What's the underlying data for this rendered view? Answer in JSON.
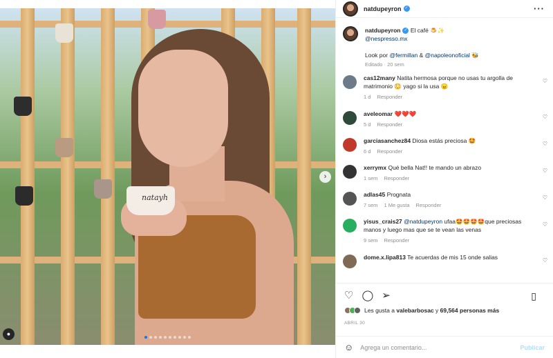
{
  "header": {
    "username": "natdupeyron",
    "more_icon": "more-horizontal-icon"
  },
  "photo": {
    "cup_text": "natayh",
    "slide_count": 10,
    "active_slide": 1
  },
  "caption": {
    "username": "natdupeyron",
    "line1": "El café 🍮✨",
    "line2": "@nespresso.mx",
    "line3_prefix": "Look por ",
    "mention1": "@fermillan",
    "and": " & ",
    "mention2": "@napoleonoficial",
    "line3_suffix": " 🐝",
    "meta": "Editado · 20 sem"
  },
  "comments": [
    {
      "user": "cas12many",
      "text": "Natita hermosa porque no usas tu argolla de matrimonio 😳 yago si la usa 😠",
      "time": "1 d",
      "reply": "Responder",
      "likes": "",
      "color": "#6c7a89"
    },
    {
      "user": "aveleomar",
      "text": "❤️❤️❤️",
      "time": "5 d",
      "reply": "Responder",
      "likes": "",
      "color": "#2e4a3a"
    },
    {
      "user": "garciasanchez84",
      "text": "Diosa estás preciosa 🤩",
      "time": "6 d",
      "reply": "Responder",
      "likes": "",
      "color": "#c0392b"
    },
    {
      "user": "xerrymx",
      "text": "Qué bella Nat!! te mando un abrazo",
      "time": "1 sem",
      "reply": "Responder",
      "likes": "",
      "color": "#333333"
    },
    {
      "user": "adlas45",
      "text": "Prognata",
      "time": "7 sem",
      "reply": "Responder",
      "likes": "1 Me gusta",
      "color": "#555555"
    },
    {
      "user": "yisus_crais27",
      "mention": "@natdupeyron",
      "text": "ufaa🤩🤩🤩🤩que preciosas manos y luego mas que se te vean las venas",
      "time": "9 sem",
      "reply": "Responder",
      "likes": "",
      "color": "#27ae60"
    },
    {
      "user": "dome.x.lipa813",
      "text": "Te acuerdas de mis 15 onde salias",
      "time": "",
      "reply": "",
      "likes": "",
      "color": "#7f6a55"
    }
  ],
  "likes": {
    "prefix": "Les gusta a ",
    "user": "valebarbosac",
    "middle": " y ",
    "count": "69,564 personas más"
  },
  "date": "ABRIL 30",
  "add_comment": {
    "placeholder": "Agrega un comentario...",
    "post_label": "Publicar"
  }
}
